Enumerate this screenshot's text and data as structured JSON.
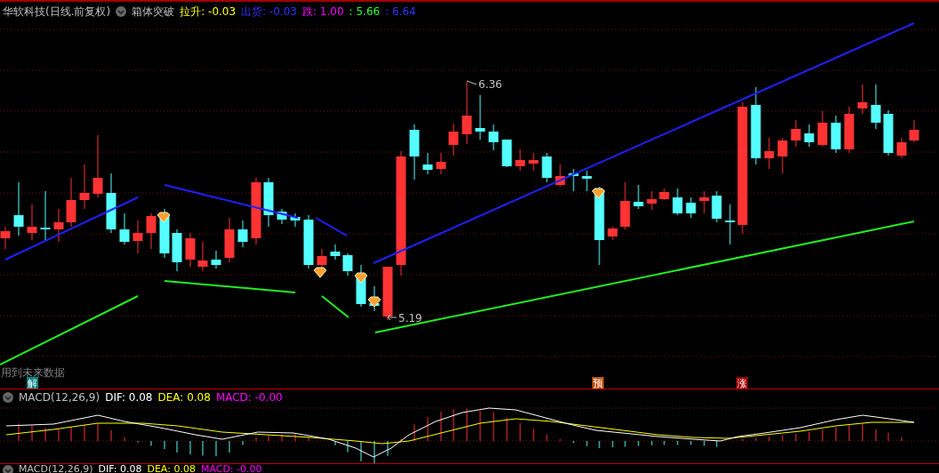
{
  "header": {
    "stock": "华软科技(日线.前复权)",
    "indicator": "箱体突破",
    "readings": [
      {
        "text": "拉升: -0.03",
        "color": "#ffff00"
      },
      {
        "text": "出货: -0.03",
        "color": "#3333ff"
      },
      {
        "text": "跌: 1.00",
        "color": "#ff00ff"
      },
      {
        "text": ": 5.66",
        "color": "#33ff33"
      },
      {
        "text": ": 6.64",
        "color": "#3333ff"
      }
    ]
  },
  "main_chart": {
    "high_label": "6.36",
    "low_label": "5.19",
    "warning": "用到未来数据",
    "badges": [
      {
        "text": "解",
        "color": "#008080"
      },
      {
        "text": "预",
        "color": "#c05010"
      },
      {
        "text": "涨",
        "color": "#a00000"
      }
    ]
  },
  "indicator_panels": [
    {
      "title": "MACD(12,26,9)",
      "readings": [
        {
          "text": "DIF: 0.08",
          "color": "#ffffff"
        },
        {
          "text": "DEA: 0.08",
          "color": "#ffff00"
        },
        {
          "text": "MACD: -0.00",
          "color": "#ff00ff"
        }
      ]
    },
    {
      "title": "MACD(12,26,9)",
      "readings": [
        {
          "text": "DIF: 0.08",
          "color": "#ffffff"
        },
        {
          "text": "DEA: 0.08",
          "color": "#ffff00"
        },
        {
          "text": "MACD: -0.00",
          "color": "#ff00ff"
        }
      ]
    }
  ]
}
